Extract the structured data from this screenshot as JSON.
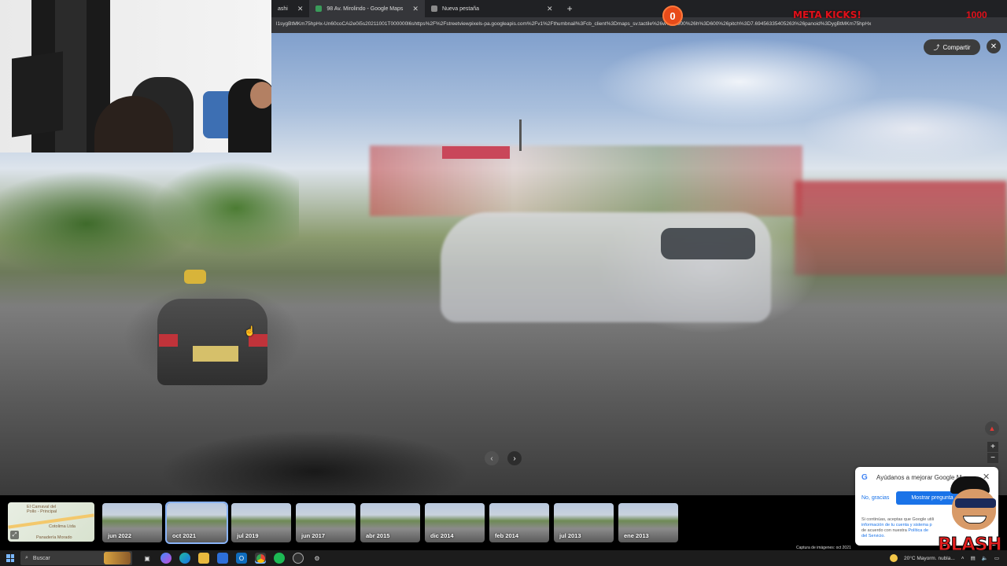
{
  "browser": {
    "tabs": [
      {
        "label": "ashi",
        "active": false
      },
      {
        "label": "98 Av. Mirolindo - Google Maps",
        "active": true
      },
      {
        "label": "Nueva pestaña",
        "active": false
      }
    ],
    "new_tab_icon": "plus-icon",
    "url": "l1sygBtMKm75hpHx-Un60coCAi2e0i5s20211001T000000l6shttps%2F%2Fstreetviewpixels-pa.googleapis.com%2Fv1%2Fthumbnail%3Fcb_client%3Dmaps_sv.tactile%26w%3D900%26h%3D600%26pitch%3D7.69456335405263%26panoid%3DygBtMKm75hpHx"
  },
  "overlay": {
    "counter": "0",
    "meta_label": "META KICKS!",
    "goal": "1000"
  },
  "streetview": {
    "share_label": "Compartir",
    "close_icon": "close-icon",
    "prev_icon": "chevron-left-icon",
    "next_icon": "chevron-right-icon"
  },
  "minimap": {
    "labels": [
      "El Carnaval del",
      "Pollo - Principal",
      "Cotolima Ltda",
      "Panadería Morado"
    ]
  },
  "timeline": {
    "thumbnails": [
      {
        "date": "jun 2022",
        "selected": false
      },
      {
        "date": "oct 2021",
        "selected": true
      },
      {
        "date": "jul 2019",
        "selected": false
      },
      {
        "date": "jun 2017",
        "selected": false
      },
      {
        "date": "abr 2015",
        "selected": false
      },
      {
        "date": "dic 2014",
        "selected": false
      },
      {
        "date": "feb 2014",
        "selected": false
      },
      {
        "date": "jul 2013",
        "selected": false
      },
      {
        "date": "ene 2013",
        "selected": false
      }
    ],
    "capture_text": "Captura de imágenes: oct 2021"
  },
  "google_popup": {
    "logo": "G",
    "title": "Ayúdanos a mejorar Google M",
    "no_thanks": "No, gracias",
    "show_question": "Mostrar pregunta",
    "small_text_1": "Si continúas, aceptas que Google utili",
    "small_link_1": "información de tu cuenta y sistema p",
    "small_text_2": "de acuerdo con nuestra ",
    "small_link_2": "Política de",
    "small_link_3": "del Servicio."
  },
  "mascot": {
    "name": "BLASH"
  },
  "taskbar": {
    "search_placeholder": "Buscar",
    "weather": "20°C  Mayorm. nubla...",
    "colors": {
      "accent": "#7ab8ff"
    }
  }
}
